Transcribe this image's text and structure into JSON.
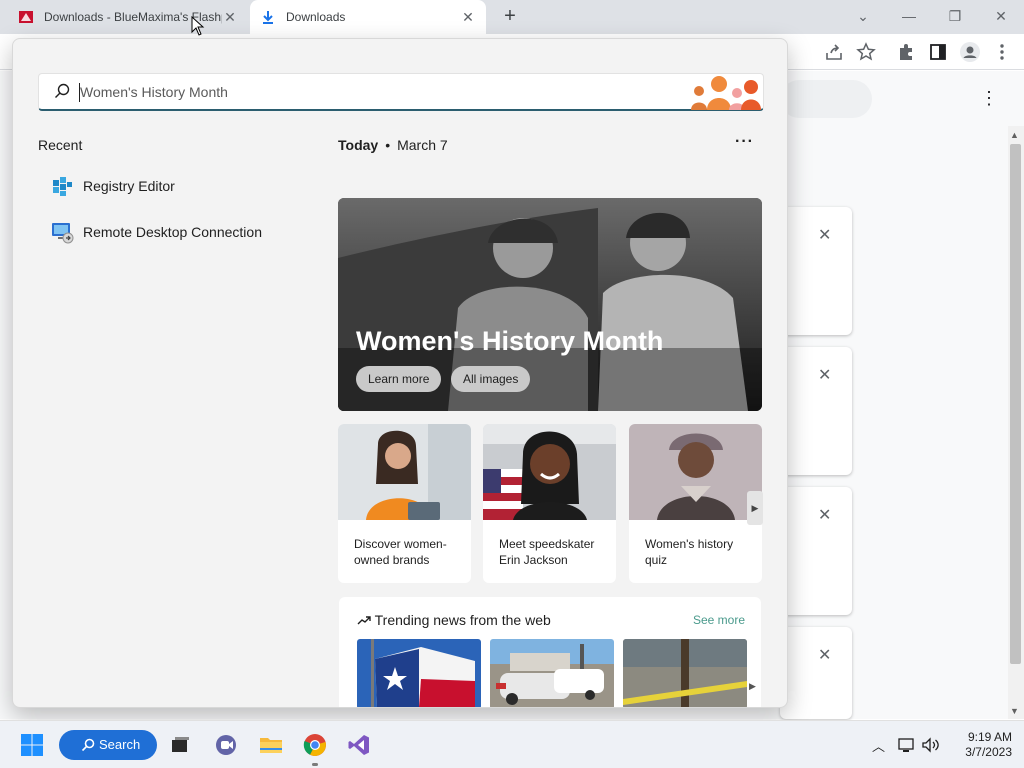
{
  "browser": {
    "tabs": [
      {
        "title": "Downloads - BlueMaxima's Flashp",
        "icon": "flashpoint-icon",
        "active": false
      },
      {
        "title": "Downloads",
        "icon": "download-icon",
        "active": true
      }
    ],
    "new_tab": "+",
    "window_controls": {
      "tab_search": "⌄",
      "minimize": "—",
      "restore": "❐",
      "close": "✕"
    },
    "toolbar_icons": [
      "share-icon",
      "bookmark-star-icon",
      "extensions-icon",
      "side-panel-icon",
      "profile-icon",
      "menu-icon"
    ]
  },
  "downloads_page": {
    "more_menu": "⋮",
    "card_close": "✕"
  },
  "search_panel": {
    "query": "Women's History Month",
    "recent": {
      "title": "Recent",
      "items": [
        {
          "label": "Registry Editor",
          "icon": "registry-editor-icon"
        },
        {
          "label": "Remote Desktop Connection",
          "icon": "remote-desktop-icon"
        }
      ]
    },
    "today": {
      "label": "Today",
      "separator": "•",
      "date": "March 7"
    },
    "more_options": "···",
    "hero": {
      "title": "Women's History Month",
      "buttons": [
        "Learn more",
        "All images"
      ]
    },
    "cards": [
      {
        "text": "Discover women-owned brands"
      },
      {
        "text": "Meet speedskater Erin Jackson"
      },
      {
        "text": "Women's history quiz"
      }
    ],
    "card_next": "▶",
    "trending": {
      "title": "Trending news from the web",
      "see_more": "See more",
      "next": "▶"
    }
  },
  "taskbar": {
    "search_label": "Search",
    "apps": [
      "start-icon",
      "task-view-icon",
      "teams-chat-icon",
      "file-explorer-icon",
      "chrome-icon",
      "visual-studio-icon"
    ],
    "tray": {
      "chevron": "︿",
      "network": "network-icon",
      "volume": "volume-icon"
    },
    "time": "9:19 AM",
    "date": "3/7/2023"
  },
  "colors": {
    "accent_search": "#1f6fd6",
    "search_underline": "#2b5d6f",
    "see_more": "#4a9a8c",
    "panel_bg": "#f3f3f3"
  }
}
